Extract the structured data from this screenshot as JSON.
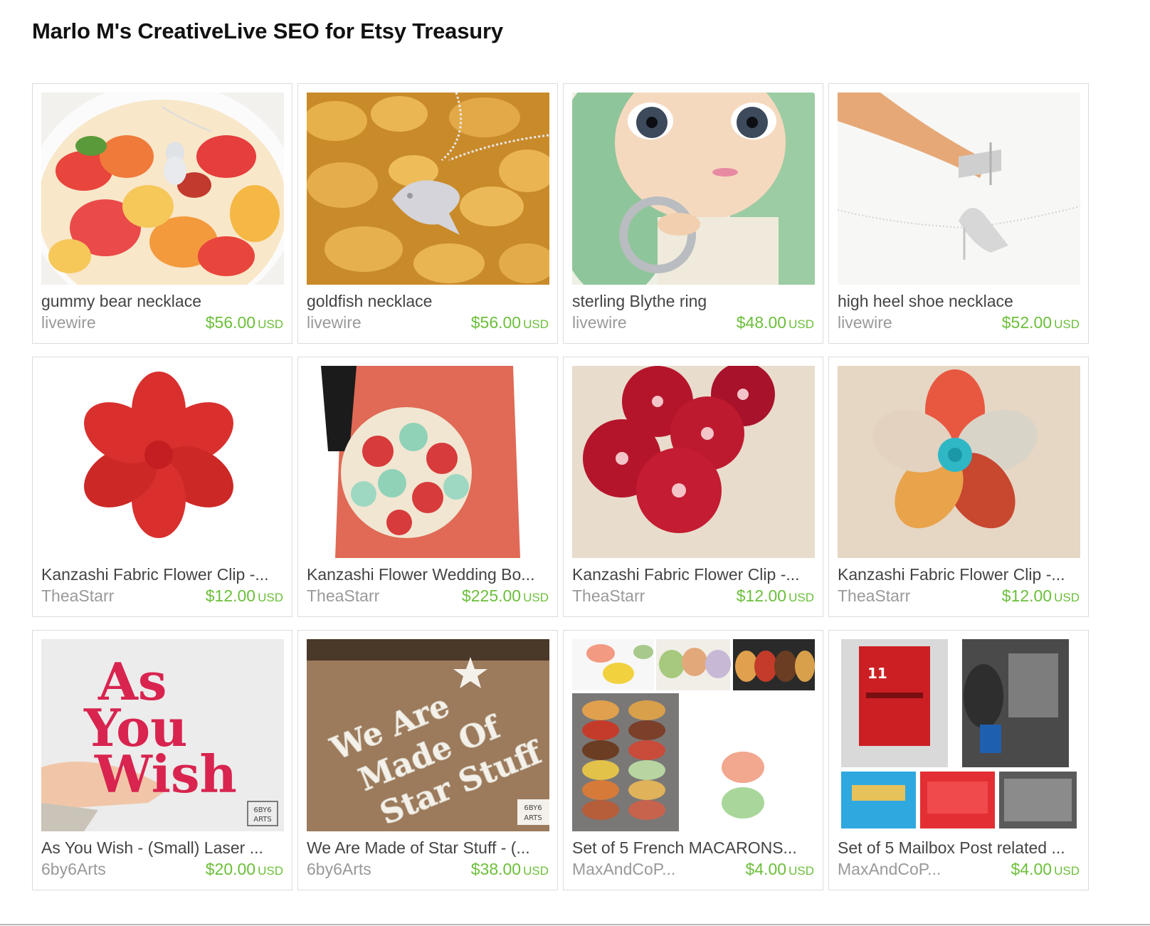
{
  "page": {
    "title": "Marlo M's CreativeLive SEO for Etsy Treasury"
  },
  "colors": {
    "price": "#6bbf3a",
    "shop": "#999999",
    "title": "#444444",
    "card_border": "#dcdcdc"
  },
  "items": [
    {
      "title": "gummy bear necklace",
      "shop": "livewire",
      "price": "$56.00",
      "currency": "USD"
    },
    {
      "title": "goldfish necklace",
      "shop": "livewire",
      "price": "$56.00",
      "currency": "USD"
    },
    {
      "title": "sterling Blythe ring",
      "shop": "livewire",
      "price": "$48.00",
      "currency": "USD"
    },
    {
      "title": "high heel shoe necklace",
      "shop": "livewire",
      "price": "$52.00",
      "currency": "USD"
    },
    {
      "title": "Kanzashi Fabric Flower Clip -...",
      "shop": "TheaStarr",
      "price": "$12.00",
      "currency": "USD"
    },
    {
      "title": "Kanzashi Flower Wedding Bo...",
      "shop": "TheaStarr",
      "price": "$225.00",
      "currency": "USD"
    },
    {
      "title": "Kanzashi Fabric Flower Clip -...",
      "shop": "TheaStarr",
      "price": "$12.00",
      "currency": "USD"
    },
    {
      "title": "Kanzashi Fabric Flower Clip -...",
      "shop": "TheaStarr",
      "price": "$12.00",
      "currency": "USD"
    },
    {
      "title": "As You Wish - (Small) Laser ...",
      "shop": "6by6Arts",
      "price": "$20.00",
      "currency": "USD"
    },
    {
      "title": "We Are Made of Star Stuff - (...",
      "shop": "6by6Arts",
      "price": "$38.00",
      "currency": "USD"
    },
    {
      "title": "Set of 5 French MACARONS...",
      "shop": "MaxAndCoP...",
      "price": "$4.00",
      "currency": "USD"
    },
    {
      "title": "Set of 5 Mailbox Post related ...",
      "shop": "MaxAndCoP...",
      "price": "$4.00",
      "currency": "USD"
    }
  ],
  "image_text": {
    "as_you_wish": [
      "As",
      "You",
      "Wish"
    ],
    "star_stuff": [
      "We Are",
      "Made Of",
      "Star Stuff"
    ],
    "brand_tag": [
      "6BY6",
      "ARTS"
    ],
    "mailbox_number": "11"
  }
}
